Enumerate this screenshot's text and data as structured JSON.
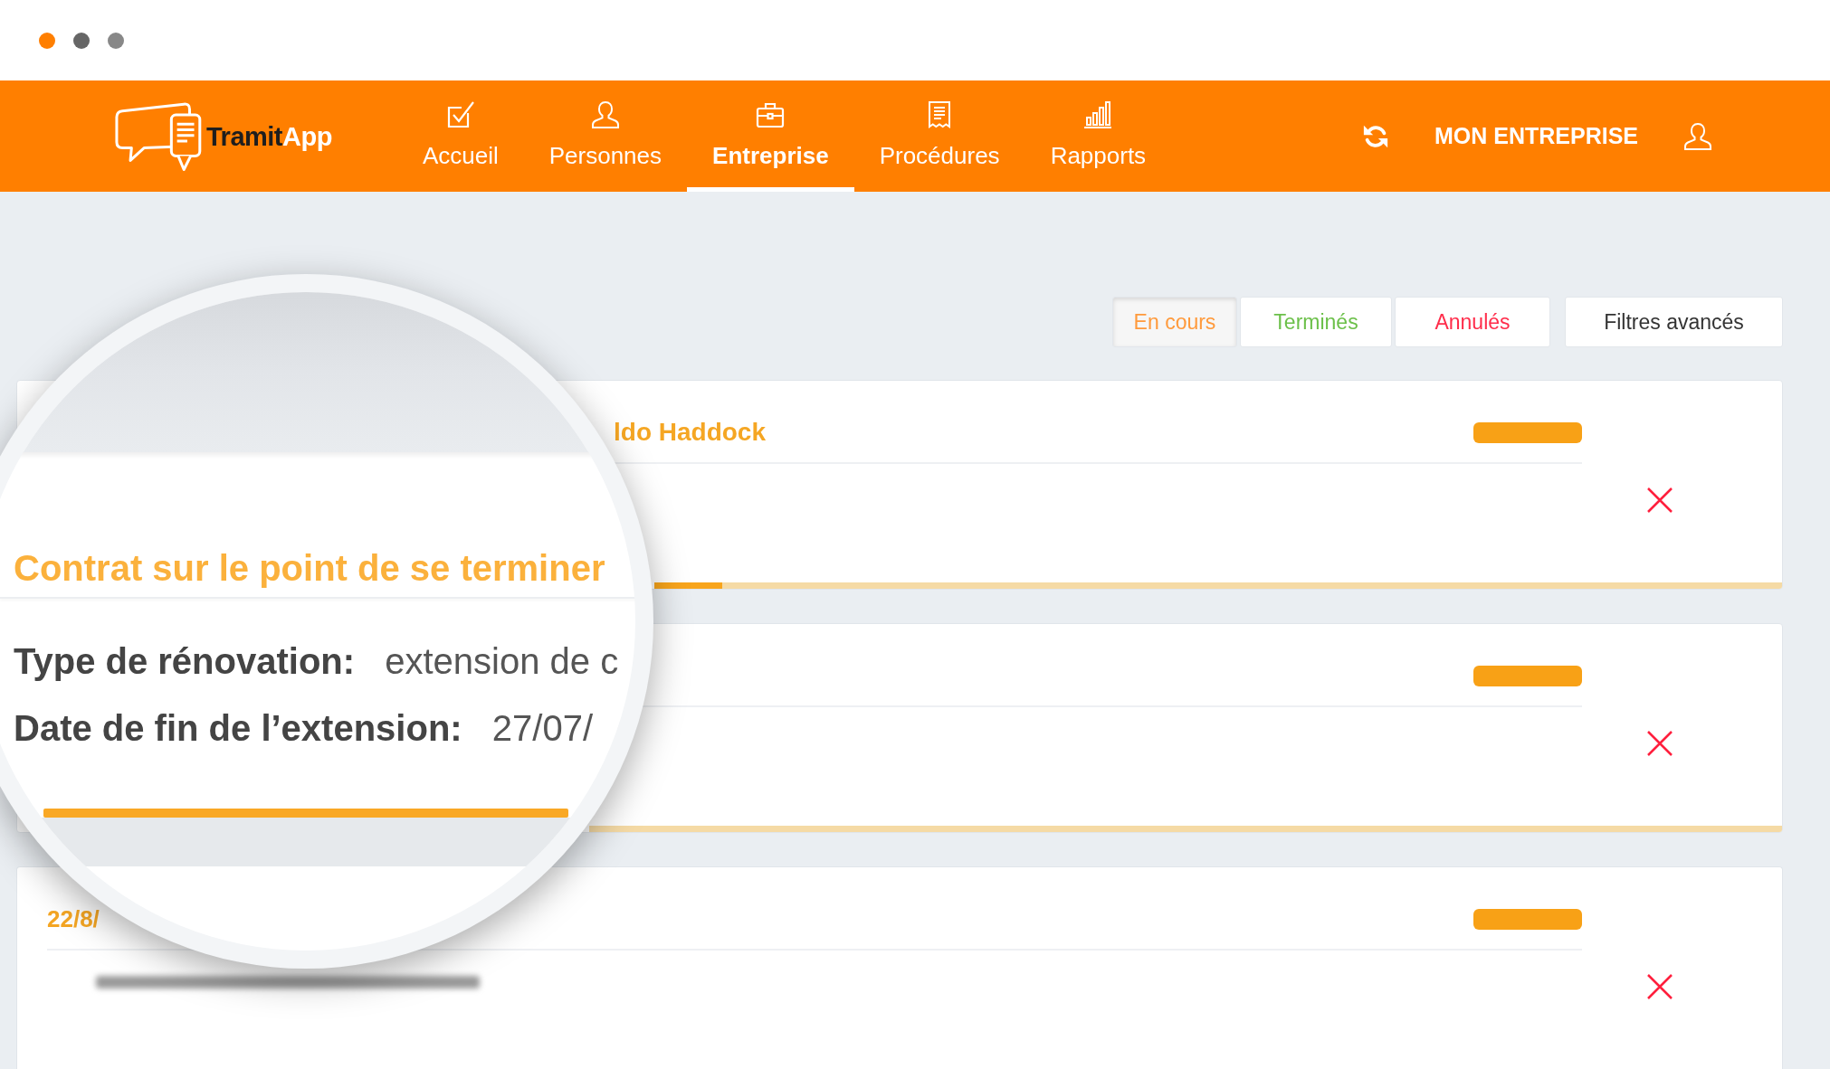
{
  "window": {
    "dots": [
      {
        "color": "#ff7f00"
      },
      {
        "color": "#666666"
      },
      {
        "color": "#888888"
      }
    ]
  },
  "navbar": {
    "logo": {
      "first": "Tramit",
      "second": "App"
    },
    "items": [
      {
        "label": "Accueil",
        "kind": "check",
        "selected": false
      },
      {
        "label": "Personnes",
        "kind": "person",
        "selected": false
      },
      {
        "label": "Entreprise",
        "kind": "briefcase",
        "selected": true
      },
      {
        "label": "Procédures",
        "kind": "receipt",
        "selected": false
      },
      {
        "label": "Rapports",
        "kind": "chart",
        "selected": false
      }
    ],
    "company": "MON ENTREPRISE"
  },
  "filters": {
    "tabs": [
      {
        "label": "En cours",
        "color": "#ff9a3c",
        "selected": true
      },
      {
        "label": "Terminés",
        "color": "#6cc04a",
        "selected": false
      },
      {
        "label": "Annulés",
        "color": "#ff2d4b",
        "selected": false
      }
    ],
    "advanced": "Filtres avancés"
  },
  "cards": [
    {
      "name": "ldo Haddock",
      "level": 0.06
    },
    {
      "track": true
    },
    {
      "date": "22/8/",
      "blurred": true
    }
  ],
  "magnifier": {
    "title": "Contrat sur le point de se terminer",
    "details": [
      {
        "label": "Type de rénovation:",
        "value": "extension de c"
      },
      {
        "label": "Date de fin de l’extension:",
        "value": "27/07/"
      }
    ]
  }
}
